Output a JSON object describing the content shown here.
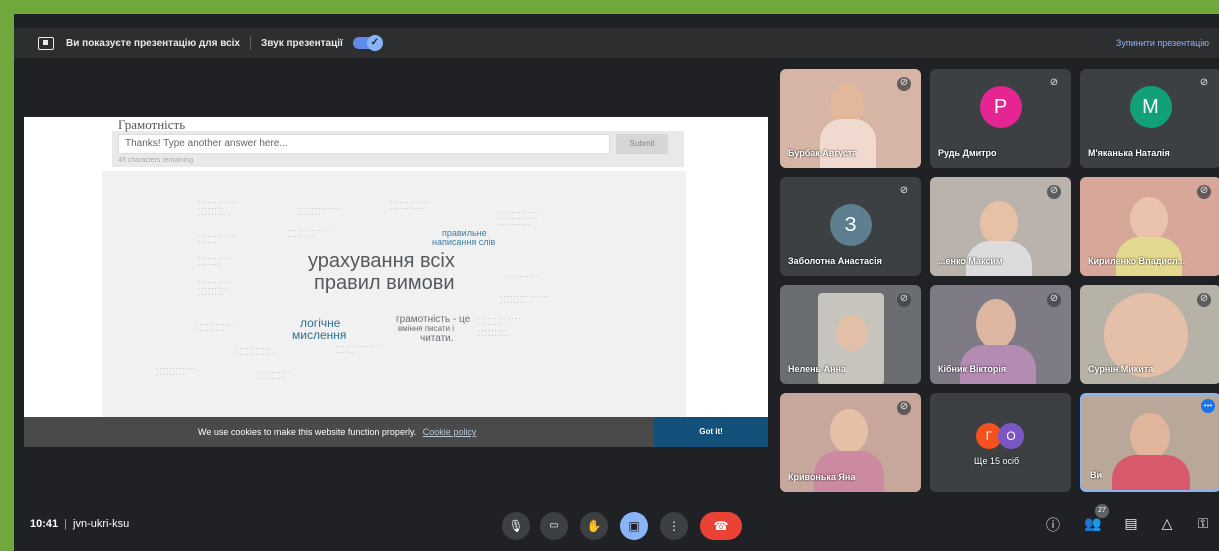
{
  "banner": {
    "presenting_text": "Ви показуєте презентацію для всіх",
    "audio_text": "Звук презентації",
    "audio_toggle_state": "✓",
    "stop_text": "Зупинити презентацію"
  },
  "slide": {
    "question_title": "Грамотність",
    "answer_placeholder": "Thanks! Type another answer here...",
    "submit_label": "Submit",
    "remaining_text": "49 characters remaining",
    "cloud_words": [
      "урахування всіх",
      "правил вимови",
      "логічне",
      "мислення",
      "правильне",
      "написання слів",
      "грамотність - це",
      "вміння писати і",
      "читати."
    ]
  },
  "cookie": {
    "message": "We use cookies to make this website function properly.",
    "policy_link": "Cookie policy",
    "got_it": "Got it!"
  },
  "participants": [
    {
      "name": "Бурбак Августа",
      "mic": "muted"
    },
    {
      "name": "Рудь Дмитро",
      "mic": "muted",
      "initial": "Р",
      "color": "#e52592"
    },
    {
      "name": "М'яканька Наталія",
      "mic": "muted",
      "initial": "М",
      "color": "#12a07a"
    },
    {
      "name": "Заболотна Анастасія",
      "mic": "muted",
      "initial": "З",
      "color": "#5e7f8f"
    },
    {
      "name": "...енко Максим",
      "mic": "muted"
    },
    {
      "name": "Кириленко Владисл...",
      "mic": "muted"
    },
    {
      "name": "Нелень Анна",
      "mic": "muted"
    },
    {
      "name": "Кібник Вікторія",
      "mic": "muted"
    },
    {
      "name": "Сурнін Микита",
      "mic": "muted"
    },
    {
      "name": "Кривонька Яна",
      "mic": "muted"
    },
    {
      "name": "Ще 15 осіб",
      "mic": "none",
      "initials": [
        "Г",
        "О"
      ]
    },
    {
      "name": "Ви",
      "mic": "more"
    }
  ],
  "bottom": {
    "time": "10:41",
    "meeting_code": "jvn-ukri-ksu",
    "participant_count": "27"
  },
  "colors": {
    "background": "#202124",
    "accent": "#8ab4f8",
    "end_call": "#ea4335"
  }
}
